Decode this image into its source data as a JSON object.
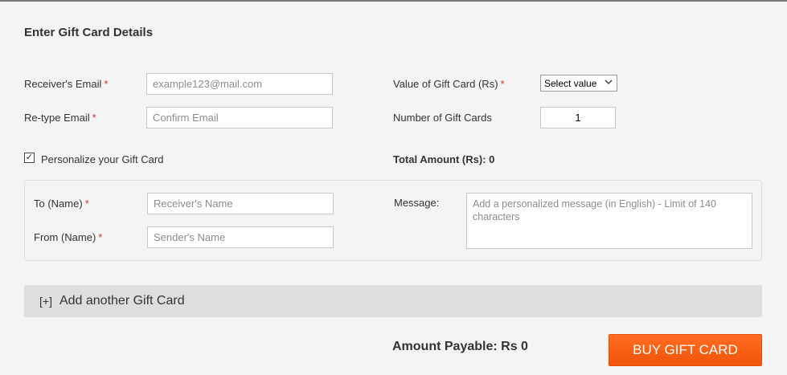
{
  "form": {
    "title": "Enter Gift Card Details",
    "receiver_email": {
      "label": "Receiver's Email",
      "placeholder": "example123@mail.com",
      "required": "*"
    },
    "retype_email": {
      "label": "Re-type Email",
      "placeholder": "Confirm Email",
      "required": "*"
    },
    "gift_value": {
      "label": "Value of Gift Card (Rs)",
      "required": "*",
      "selected": "Select value"
    },
    "num_cards": {
      "label": "Number of Gift Cards",
      "value": "1"
    },
    "personalize": {
      "label": "Personalize your Gift Card",
      "checked": true,
      "check_glyph": "✓"
    },
    "total_amount": "Total Amount (Rs): 0",
    "personal": {
      "to_name": {
        "label": "To (Name)",
        "placeholder": "Receiver's Name",
        "required": "*"
      },
      "from_name": {
        "label": "From (Name)",
        "placeholder": "Sender's Name",
        "required": "*"
      },
      "message": {
        "label": "Message:",
        "placeholder": "Add a personalized message (in English) - Limit of 140 characters"
      }
    },
    "add_another": {
      "prefix": "[+]",
      "label": "Add another Gift Card"
    },
    "amount_payable": "Amount Payable: Rs 0",
    "buy_button": "BUY GIFT CARD"
  },
  "colors": {
    "accent": "#f55a0f",
    "required": "#d9302a",
    "background": "#f4f4f4"
  }
}
